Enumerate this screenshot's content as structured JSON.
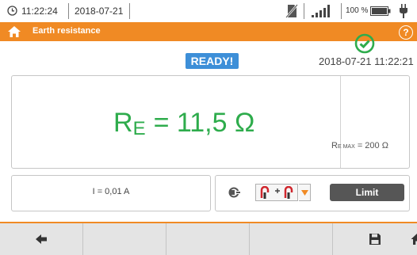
{
  "status": {
    "time": "11:22:24",
    "date": "2018-07-21",
    "battery_percent": "100 %",
    "icons": [
      "clock-icon",
      "sd-card-disabled-icon",
      "signal-strength-icon",
      "battery-icon",
      "power-plug-icon"
    ]
  },
  "titlebar": {
    "title": "Earth resistance",
    "help_label": "?",
    "color": "#f08a24"
  },
  "main": {
    "status_badge": "READY!",
    "datetime": "2018-07-21 11:22:21",
    "result_symbol": "R",
    "result_subscript": "E",
    "result_value": "= 11,5 Ω",
    "result_color": "#2eac4c",
    "limit_prefix": "R",
    "limit_subscript": "E MAX",
    "limit_value": "= 200 Ω"
  },
  "current": {
    "text": "I = 0,01 A"
  },
  "controls": {
    "limit_button": "Limit"
  },
  "toolbar": {
    "buttons": [
      {
        "name": "back",
        "icon": "arrow-left-icon"
      },
      {
        "name": "empty-1",
        "icon": ""
      },
      {
        "name": "empty-2",
        "icon": ""
      },
      {
        "name": "empty-3",
        "icon": ""
      },
      {
        "name": "save",
        "icon": "save-icon"
      },
      {
        "name": "home",
        "icon": "home-icon"
      }
    ]
  }
}
